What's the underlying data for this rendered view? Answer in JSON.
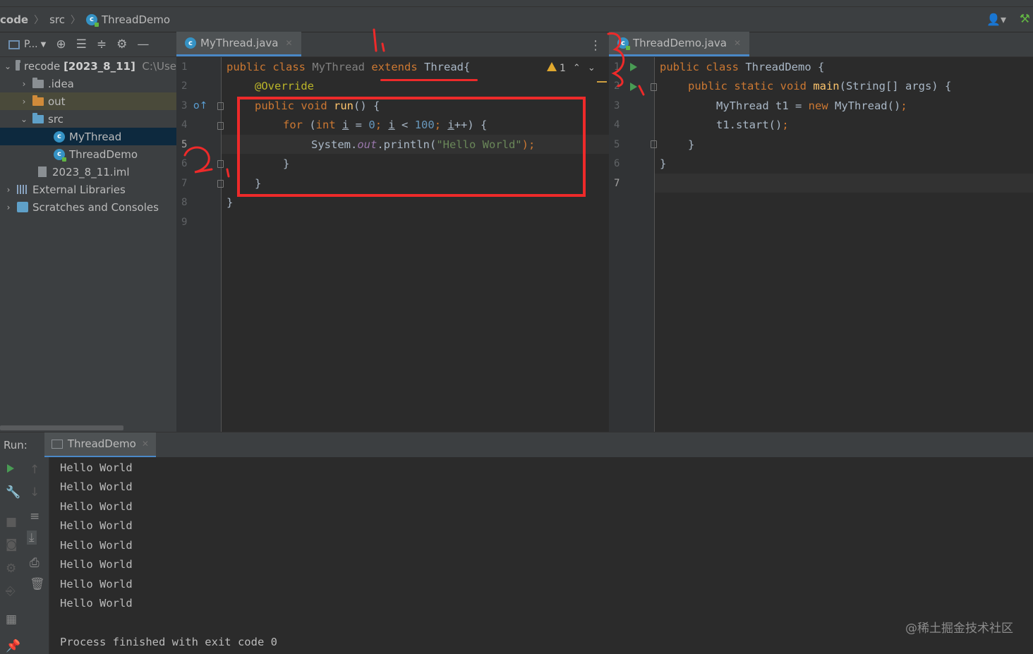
{
  "breadcrumb": {
    "root": "code",
    "folder": "src",
    "file": "ThreadDemo"
  },
  "project_panel": {
    "title": "P...",
    "tree": [
      {
        "label": "recode",
        "bold": "[2023_8_11]",
        "path": "C:\\Use"
      },
      {
        "label": ".idea"
      },
      {
        "label": "out"
      },
      {
        "label": "src"
      },
      {
        "label": "MyThread"
      },
      {
        "label": "ThreadDemo"
      },
      {
        "label": "2023_8_11.iml"
      },
      {
        "label": "External Libraries"
      },
      {
        "label": "Scratches and Consoles"
      }
    ]
  },
  "left_editor": {
    "tab": "MyThread.java",
    "line_numbers": [
      "1",
      "2",
      "3",
      "4",
      "5",
      "6",
      "7",
      "8",
      "9"
    ],
    "warning_count": "1",
    "code": {
      "l1_public": "public ",
      "l1_class": "class ",
      "l1_name": "MyThread ",
      "l1_extends": "extends",
      "l1_rest": " Thread{",
      "l2_ann": "@Override",
      "l3_kw": "public void ",
      "l3_fn": "run",
      "l3_rest": "() {",
      "l4_for": "for ",
      "l4_p1": "(",
      "l4_int": "int ",
      "l4_i1": "i",
      "l4_eq": " = ",
      "l4_zero": "0",
      "l4_semi1": "; ",
      "l4_i2": "i",
      "l4_lt": " < ",
      "l4_hundred": "100",
      "l4_semi2": "; ",
      "l4_i3": "i",
      "l4_end": "++) {",
      "l5_sys": "System.",
      "l5_out": "out",
      "l5_println": ".println(",
      "l5_str": "\"Hello World\"",
      "l5_end": ");",
      "l6": "}",
      "l7": "}",
      "l8": "}"
    }
  },
  "right_editor": {
    "tab": "ThreadDemo.java",
    "line_numbers": [
      "1",
      "2",
      "3",
      "4",
      "5",
      "6",
      "7"
    ],
    "code": {
      "l1_kw": "public class ",
      "l1_rest": "ThreadDemo {",
      "l2_kw": "public static void ",
      "l2_fn": "main",
      "l2_rest": "(String[] args) {",
      "l3_a": "MyThread t1 = ",
      "l3_new": "new ",
      "l3_b": "MyThread()",
      "l3_semi": ";",
      "l4_a": "t1.start()",
      "l4_semi": ";",
      "l5": "}",
      "l6": "}"
    }
  },
  "run_panel": {
    "label": "Run:",
    "tab": "ThreadDemo",
    "output": [
      "Hello World",
      "Hello World",
      "Hello World",
      "Hello World",
      "Hello World",
      "Hello World",
      "Hello World",
      "Hello World"
    ],
    "exit_message": "Process finished with exit code 0"
  },
  "watermark": "@稀土掘金技术社区",
  "colors": {
    "keyword": "#cc7832",
    "string": "#6a8759",
    "number": "#6897bb",
    "annotation_red": "#ee2a2a",
    "selection": "#0d293e"
  }
}
